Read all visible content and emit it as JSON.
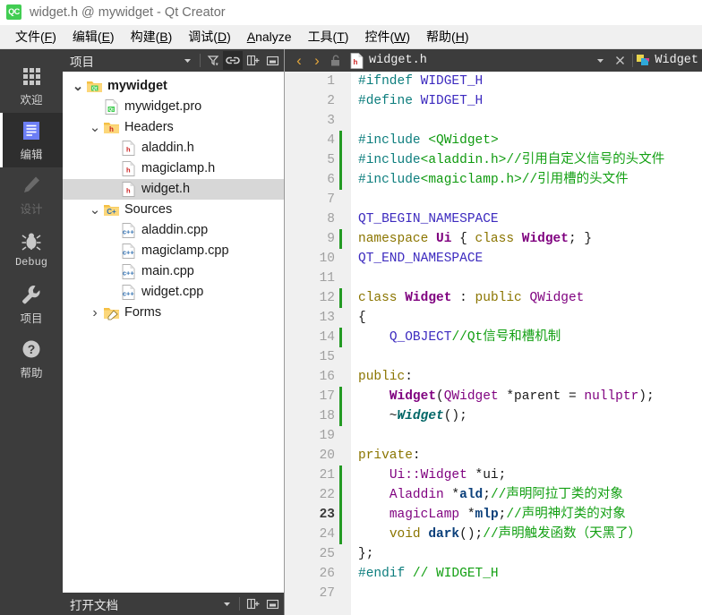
{
  "window": {
    "logo_text": "QC",
    "title": "widget.h @ mywidget - Qt Creator"
  },
  "menubar": {
    "items": [
      {
        "text": "文件(F)",
        "mnemonic": "F"
      },
      {
        "text": "编辑(E)",
        "mnemonic": "E"
      },
      {
        "text": "构建(B)",
        "mnemonic": "B"
      },
      {
        "text": "调试(D)",
        "mnemonic": "D"
      },
      {
        "text": "Analyze",
        "mnemonic": "A"
      },
      {
        "text": "工具(T)",
        "mnemonic": "T"
      },
      {
        "text": "控件(W)",
        "mnemonic": "W"
      },
      {
        "text": "帮助(H)",
        "mnemonic": "H"
      }
    ]
  },
  "modebar": {
    "items": [
      {
        "label": "欢迎",
        "icon": "grid-icon",
        "state": "normal"
      },
      {
        "label": "编辑",
        "icon": "document-icon",
        "state": "selected"
      },
      {
        "label": "设计",
        "icon": "pencil-icon",
        "state": "disabled"
      },
      {
        "label": "Debug",
        "icon": "bug-icon",
        "state": "normal"
      },
      {
        "label": "项目",
        "icon": "wrench-icon",
        "state": "normal"
      },
      {
        "label": "帮助",
        "icon": "question-icon",
        "state": "normal"
      }
    ]
  },
  "project_panel": {
    "title": "项目",
    "toolbar": [
      {
        "icon": "chevron-down-icon",
        "name": "view-selector-dropdown",
        "active": false
      },
      {
        "icon": "filter-icon",
        "name": "filter-button",
        "active": false
      },
      {
        "icon": "link-icon",
        "name": "sync-selection-button",
        "active": true
      },
      {
        "icon": "split-add-icon",
        "name": "split-button",
        "active": false
      },
      {
        "icon": "close-panel-icon",
        "name": "close-panel-button",
        "active": false
      }
    ],
    "tree": [
      {
        "label": "mywidget",
        "indent": 0,
        "arrow": "down",
        "icon": "qt-project-icon",
        "bold": true,
        "selected": false
      },
      {
        "label": "mywidget.pro",
        "indent": 1,
        "arrow": "none",
        "icon": "pro-file-icon",
        "bold": false,
        "selected": false
      },
      {
        "label": "Headers",
        "indent": 1,
        "arrow": "down",
        "icon": "folder-h-icon",
        "bold": false,
        "selected": false
      },
      {
        "label": "aladdin.h",
        "indent": 2,
        "arrow": "none",
        "icon": "header-file-icon",
        "bold": false,
        "selected": false
      },
      {
        "label": "magiclamp.h",
        "indent": 2,
        "arrow": "none",
        "icon": "header-file-icon",
        "bold": false,
        "selected": false
      },
      {
        "label": "widget.h",
        "indent": 2,
        "arrow": "none",
        "icon": "header-file-icon",
        "bold": false,
        "selected": true
      },
      {
        "label": "Sources",
        "indent": 1,
        "arrow": "down",
        "icon": "folder-cpp-icon",
        "bold": false,
        "selected": false
      },
      {
        "label": "aladdin.cpp",
        "indent": 2,
        "arrow": "none",
        "icon": "cpp-file-icon",
        "bold": false,
        "selected": false
      },
      {
        "label": "magiclamp.cpp",
        "indent": 2,
        "arrow": "none",
        "icon": "cpp-file-icon",
        "bold": false,
        "selected": false
      },
      {
        "label": "main.cpp",
        "indent": 2,
        "arrow": "none",
        "icon": "cpp-file-icon",
        "bold": false,
        "selected": false
      },
      {
        "label": "widget.cpp",
        "indent": 2,
        "arrow": "none",
        "icon": "cpp-file-icon",
        "bold": false,
        "selected": false
      },
      {
        "label": "Forms",
        "indent": 1,
        "arrow": "right",
        "icon": "folder-ui-icon",
        "bold": false,
        "selected": false
      }
    ],
    "open_documents_title": "打开文档"
  },
  "editor": {
    "toolbar": {
      "back_label": "‹",
      "forward_label": "›",
      "lock_icon": "unlocked-icon",
      "file_icon": "header-file-icon",
      "filename": "widget.h",
      "dropdown_icon": "chevron-down-icon",
      "close_label": "✕",
      "symbol_icon": "class-symbol-icon",
      "symbol": "Widget"
    },
    "current_line": 23,
    "lines": [
      {
        "n": 1,
        "changed": false,
        "fold": false,
        "tokens": [
          {
            "t": "#ifndef ",
            "c": "pre"
          },
          {
            "t": "WIDGET_H",
            "c": "mac"
          }
        ]
      },
      {
        "n": 2,
        "changed": false,
        "fold": false,
        "tokens": [
          {
            "t": "#define ",
            "c": "pre"
          },
          {
            "t": "WIDGET_H",
            "c": "mac"
          }
        ]
      },
      {
        "n": 3,
        "changed": false,
        "fold": false,
        "tokens": []
      },
      {
        "n": 4,
        "changed": true,
        "fold": false,
        "tokens": [
          {
            "t": "#include ",
            "c": "pre"
          },
          {
            "t": "<QWidget>",
            "c": "str"
          }
        ]
      },
      {
        "n": 5,
        "changed": true,
        "fold": false,
        "tokens": [
          {
            "t": "#include",
            "c": "pre"
          },
          {
            "t": "<aladdin.h>",
            "c": "str"
          },
          {
            "t": "//引用自定义信号的头文件",
            "c": "cmt"
          }
        ]
      },
      {
        "n": 6,
        "changed": true,
        "fold": false,
        "tokens": [
          {
            "t": "#include",
            "c": "pre"
          },
          {
            "t": "<magiclamp.h>",
            "c": "str"
          },
          {
            "t": "//引用槽的头文件",
            "c": "cmt"
          }
        ]
      },
      {
        "n": 7,
        "changed": false,
        "fold": false,
        "tokens": []
      },
      {
        "n": 8,
        "changed": false,
        "fold": false,
        "tokens": [
          {
            "t": "QT_BEGIN_NAMESPACE",
            "c": "mac"
          }
        ]
      },
      {
        "n": 9,
        "changed": true,
        "fold": false,
        "tokens": [
          {
            "t": "namespace ",
            "c": "kw"
          },
          {
            "t": "Ui",
            "c": "cls"
          },
          {
            "t": " { ",
            "c": "plain"
          },
          {
            "t": "class ",
            "c": "kw"
          },
          {
            "t": "Widget",
            "c": "cls"
          },
          {
            "t": "; }",
            "c": "plain"
          }
        ]
      },
      {
        "n": 10,
        "changed": false,
        "fold": false,
        "tokens": [
          {
            "t": "QT_END_NAMESPACE",
            "c": "mac"
          }
        ]
      },
      {
        "n": 11,
        "changed": false,
        "fold": false,
        "tokens": []
      },
      {
        "n": 12,
        "changed": true,
        "fold": true,
        "tokens": [
          {
            "t": "class ",
            "c": "kw"
          },
          {
            "t": "Widget",
            "c": "cls"
          },
          {
            "t": " : ",
            "c": "plain"
          },
          {
            "t": "public ",
            "c": "kw"
          },
          {
            "t": "QWidget",
            "c": "type"
          }
        ]
      },
      {
        "n": 13,
        "changed": false,
        "fold": false,
        "tokens": [
          {
            "t": "{",
            "c": "plain"
          }
        ]
      },
      {
        "n": 14,
        "changed": true,
        "fold": false,
        "tokens": [
          {
            "t": "    ",
            "c": "plain"
          },
          {
            "t": "Q_OBJECT",
            "c": "mac"
          },
          {
            "t": "//Qt信号和槽机制",
            "c": "cmt"
          }
        ]
      },
      {
        "n": 15,
        "changed": false,
        "fold": false,
        "tokens": []
      },
      {
        "n": 16,
        "changed": false,
        "fold": false,
        "tokens": [
          {
            "t": "public",
            "c": "kw"
          },
          {
            "t": ":",
            "c": "plain"
          }
        ]
      },
      {
        "n": 17,
        "changed": true,
        "fold": false,
        "tokens": [
          {
            "t": "    ",
            "c": "plain"
          },
          {
            "t": "Widget",
            "c": "cls"
          },
          {
            "t": "(",
            "c": "plain"
          },
          {
            "t": "QWidget",
            "c": "type"
          },
          {
            "t": " *parent = ",
            "c": "plain"
          },
          {
            "t": "nullptr",
            "c": "type"
          },
          {
            "t": ");",
            "c": "plain"
          }
        ]
      },
      {
        "n": 18,
        "changed": true,
        "fold": false,
        "tokens": [
          {
            "t": "    ~",
            "c": "plain"
          },
          {
            "t": "Widget",
            "c": "cls-i"
          },
          {
            "t": "();",
            "c": "plain"
          }
        ]
      },
      {
        "n": 19,
        "changed": false,
        "fold": false,
        "tokens": []
      },
      {
        "n": 20,
        "changed": false,
        "fold": false,
        "tokens": [
          {
            "t": "private",
            "c": "kw"
          },
          {
            "t": ":",
            "c": "plain"
          }
        ]
      },
      {
        "n": 21,
        "changed": true,
        "fold": false,
        "tokens": [
          {
            "t": "    ",
            "c": "plain"
          },
          {
            "t": "Ui::Widget",
            "c": "type"
          },
          {
            "t": " *ui;",
            "c": "plain"
          }
        ]
      },
      {
        "n": 22,
        "changed": true,
        "fold": false,
        "tokens": [
          {
            "t": "    ",
            "c": "plain"
          },
          {
            "t": "Aladdin",
            "c": "type"
          },
          {
            "t": " *",
            "c": "plain"
          },
          {
            "t": "ald",
            "c": "fn"
          },
          {
            "t": ";",
            "c": "plain"
          },
          {
            "t": "//声明阿拉丁类的对象",
            "c": "cmt"
          }
        ]
      },
      {
        "n": 23,
        "changed": true,
        "fold": false,
        "tokens": [
          {
            "t": "    ",
            "c": "plain"
          },
          {
            "t": "magicLamp",
            "c": "type"
          },
          {
            "t": " *",
            "c": "plain"
          },
          {
            "t": "mlp",
            "c": "fn"
          },
          {
            "t": ";",
            "c": "plain"
          },
          {
            "t": "//声明神灯类的对象",
            "c": "cmt"
          }
        ]
      },
      {
        "n": 24,
        "changed": true,
        "fold": false,
        "tokens": [
          {
            "t": "    ",
            "c": "plain"
          },
          {
            "t": "void ",
            "c": "kw"
          },
          {
            "t": "dark",
            "c": "fn"
          },
          {
            "t": "();",
            "c": "plain"
          },
          {
            "t": "//声明触发函数（天黑了）",
            "c": "cmt"
          }
        ]
      },
      {
        "n": 25,
        "changed": false,
        "fold": false,
        "tokens": [
          {
            "t": "};",
            "c": "plain"
          }
        ]
      },
      {
        "n": 26,
        "changed": false,
        "fold": false,
        "tokens": [
          {
            "t": "#endif ",
            "c": "pre"
          },
          {
            "t": "// WIDGET_H",
            "c": "cmt"
          }
        ]
      },
      {
        "n": 27,
        "changed": false,
        "fold": false,
        "tokens": []
      }
    ]
  },
  "colors": {
    "chrome_dark": "#3c3c3c",
    "modebar": "#3c3c3c",
    "mode_selected": "#2e2e2e",
    "accent_green": "#41cd52",
    "change_marker": "#239a23",
    "tree_selection": "#d7d7d7",
    "gutter": "#f0f0f0"
  }
}
